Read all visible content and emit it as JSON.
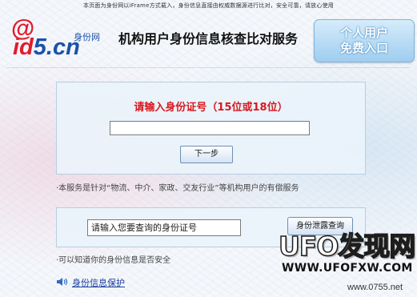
{
  "header": {
    "notice": "本页面为身份网以iFrame方式载入，身份信息直接由权威数据源进行比对，安全可靠，请放心使用",
    "logo_at": "@",
    "logo_part1": "id",
    "logo_part2": "5.cn",
    "logo_sub": "身份网",
    "title": "机构用户身份信息核查比对服务",
    "personal_entry_line1": "个人用户",
    "personal_entry_line2": "免费入口"
  },
  "verify": {
    "prompt": "请输入身份证号（15位或18位）",
    "id_value": "",
    "next_label": "下一步",
    "note": "·本服务是针对“物流、中介、家政、交友行业”等机构用户的有偿服务"
  },
  "leak_check": {
    "placeholder": "请输入您要查询的身份证号",
    "button_label": "身份泄露查询",
    "note": "·可以知道你的身份信息是否安全"
  },
  "footer": {
    "protect_link": "身份信息保护"
  },
  "watermark": {
    "brand": "UFO发现网",
    "url": "WWW.UFOFXW.COM",
    "small": "www.0755.net"
  },
  "icons": {
    "speaker": "speaker-icon"
  },
  "colors": {
    "accent_red": "#d8191f",
    "brand_blue": "#1a52a8",
    "link_blue": "#1a3fa0"
  }
}
